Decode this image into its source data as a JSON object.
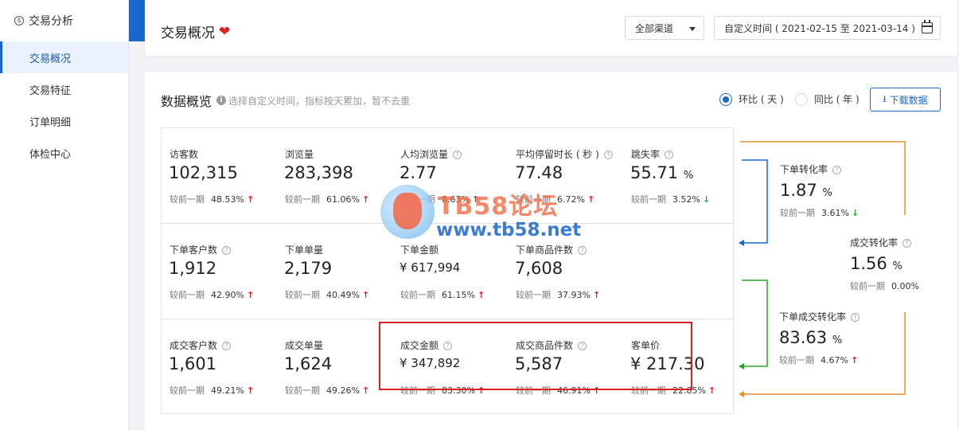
{
  "sidebar": {
    "header": "交易分析",
    "header_icon": "yuan-circle-icon",
    "items": [
      {
        "label": "交易概况",
        "active": true
      },
      {
        "label": "交易特征",
        "active": false
      },
      {
        "label": "订单明细",
        "active": false
      },
      {
        "label": "体检中心",
        "active": false
      }
    ]
  },
  "header": {
    "title": "交易概况",
    "heart": "❤",
    "channel": "全部渠道",
    "date_range": "自定义时间 ( 2021-02-15 至 2021-03-14 )"
  },
  "overview": {
    "title": "数据概览",
    "hint": "选择自定义时间，指标按天累加，暂不去重",
    "radio_options": [
      {
        "label": "环比 ( 天 )",
        "checked": true
      },
      {
        "label": "同比 ( 年 )",
        "checked": false
      }
    ],
    "download": "下载数据",
    "compare_label": "较前一期"
  },
  "metrics": [
    [
      {
        "label": "访客数",
        "help": false,
        "value": "102,315",
        "unit": "",
        "pct": "48.53%",
        "trend": "up"
      },
      {
        "label": "浏览量",
        "help": false,
        "value": "283,398",
        "unit": "",
        "pct": "61.06%",
        "trend": "up"
      },
      {
        "label": "人均浏览量",
        "help": true,
        "value": "2.77",
        "unit": "",
        "pct": "8.63%",
        "trend": "up"
      },
      {
        "label": "平均停留时长 ( 秒 )",
        "help": true,
        "value": "77.48",
        "unit": "",
        "pct": "6.72%",
        "trend": "up"
      },
      {
        "label": "跳失率",
        "help": true,
        "value": "55.71",
        "unit": "%",
        "pct": "3.52%",
        "trend": "down"
      }
    ],
    [
      {
        "label": "下单客户数",
        "help": true,
        "value": "1,912",
        "unit": "",
        "pct": "42.90%",
        "trend": "up"
      },
      {
        "label": "下单单量",
        "help": false,
        "value": "2,179",
        "unit": "",
        "pct": "40.49%",
        "trend": "up"
      },
      {
        "label": "下单金额",
        "help": false,
        "value": "¥ 617,994",
        "unit": "",
        "pct": "61.15%",
        "trend": "up",
        "small": true
      },
      {
        "label": "下单商品件数",
        "help": true,
        "value": "7,608",
        "unit": "",
        "pct": "37.93%",
        "trend": "up"
      }
    ],
    [
      {
        "label": "成交客户数",
        "help": true,
        "value": "1,601",
        "unit": "",
        "pct": "49.21%",
        "trend": "up"
      },
      {
        "label": "成交单量",
        "help": false,
        "value": "1,624",
        "unit": "",
        "pct": "49.26%",
        "trend": "up"
      },
      {
        "label": "成交金额",
        "help": true,
        "value": "¥ 347,892",
        "unit": "",
        "pct": "83.30%",
        "trend": "up",
        "small": true
      },
      {
        "label": "成交商品件数",
        "help": true,
        "value": "5,587",
        "unit": "",
        "pct": "46.91%",
        "trend": "up"
      },
      {
        "label": "客单价",
        "help": false,
        "value": "¥ 217.30",
        "unit": "",
        "pct": "22.85%",
        "trend": "up"
      }
    ]
  ],
  "funnel": [
    {
      "label": "下单转化率",
      "value": "1.87",
      "unit": "%",
      "pct": "3.61%",
      "trend": "down"
    },
    {
      "label": "成交转化率",
      "value": "1.56",
      "unit": "%",
      "pct": "0.00%",
      "trend": "none"
    },
    {
      "label": "下单成交转化率",
      "value": "83.63",
      "unit": "%",
      "pct": "4.67%",
      "trend": "up"
    }
  ],
  "watermark": {
    "title": "TB58论坛",
    "url": "www.tb58.net"
  },
  "colors": {
    "accent": "#1a66cc",
    "up": "#e02020",
    "down": "#2aa52a",
    "orange_line": "#e8912c",
    "green_line": "#2aa52a",
    "blue_line": "#1a66cc"
  }
}
